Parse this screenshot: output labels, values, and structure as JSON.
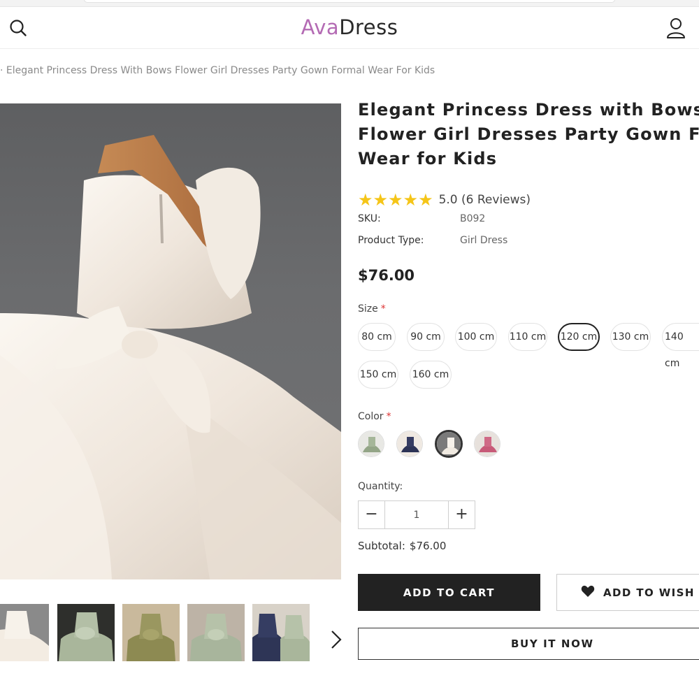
{
  "header": {
    "logo_part1": "Ava",
    "logo_part2": "Dress",
    "search_icon": "search-icon",
    "account_icon": "user-icon"
  },
  "breadcrumb": {
    "current": "· Elegant Princess Dress With Bows Flower Girl Dresses Party Gown Formal Wear For Kids"
  },
  "product": {
    "title_lines": [
      "Elegant Princess Dress with Bows",
      "Flower Girl Dresses Party Gown Formal",
      "Wear for Kids"
    ],
    "rating": {
      "stars": "★★★★★",
      "text": "5.0 (6 Reviews)",
      "star_color": "#f5c518"
    },
    "sku_label": "SKU:",
    "sku_value": "B092",
    "type_label": "Product Type:",
    "type_value": "Girl Dress",
    "price": "$76.00"
  },
  "options": {
    "size_label": "Size",
    "required_mark": "*",
    "sizes": [
      "80 cm",
      "90 cm",
      "100 cm",
      "110 cm",
      "120 cm",
      "130 cm",
      "140 cm",
      "150 cm",
      "160 cm"
    ],
    "selected_size": "120 cm",
    "color_label": "Color",
    "colors": [
      "sage green",
      "navy",
      "ivory",
      "rose pink"
    ],
    "selected_color": "ivory"
  },
  "quantity": {
    "label": "Quantity:",
    "minus": "−",
    "value": "1",
    "plus": "+"
  },
  "subtotal": {
    "label": "Subtotal:",
    "value": "$76.00"
  },
  "actions": {
    "add_to_cart": "ADD TO CART",
    "wishlist": "ADD TO WISH LIST",
    "buy_now": "BUY IT NOW"
  },
  "gallery": {
    "thumbnails": [
      "ivory dress",
      "sage dress",
      "olive dress",
      "sage dress side",
      "navy and sage dresses"
    ],
    "next_icon": "chevron-right-icon"
  },
  "colors": {
    "brand_accent": "#b46bb4",
    "dark": "#222222",
    "star": "#f5c518",
    "required": "#dd3333"
  }
}
